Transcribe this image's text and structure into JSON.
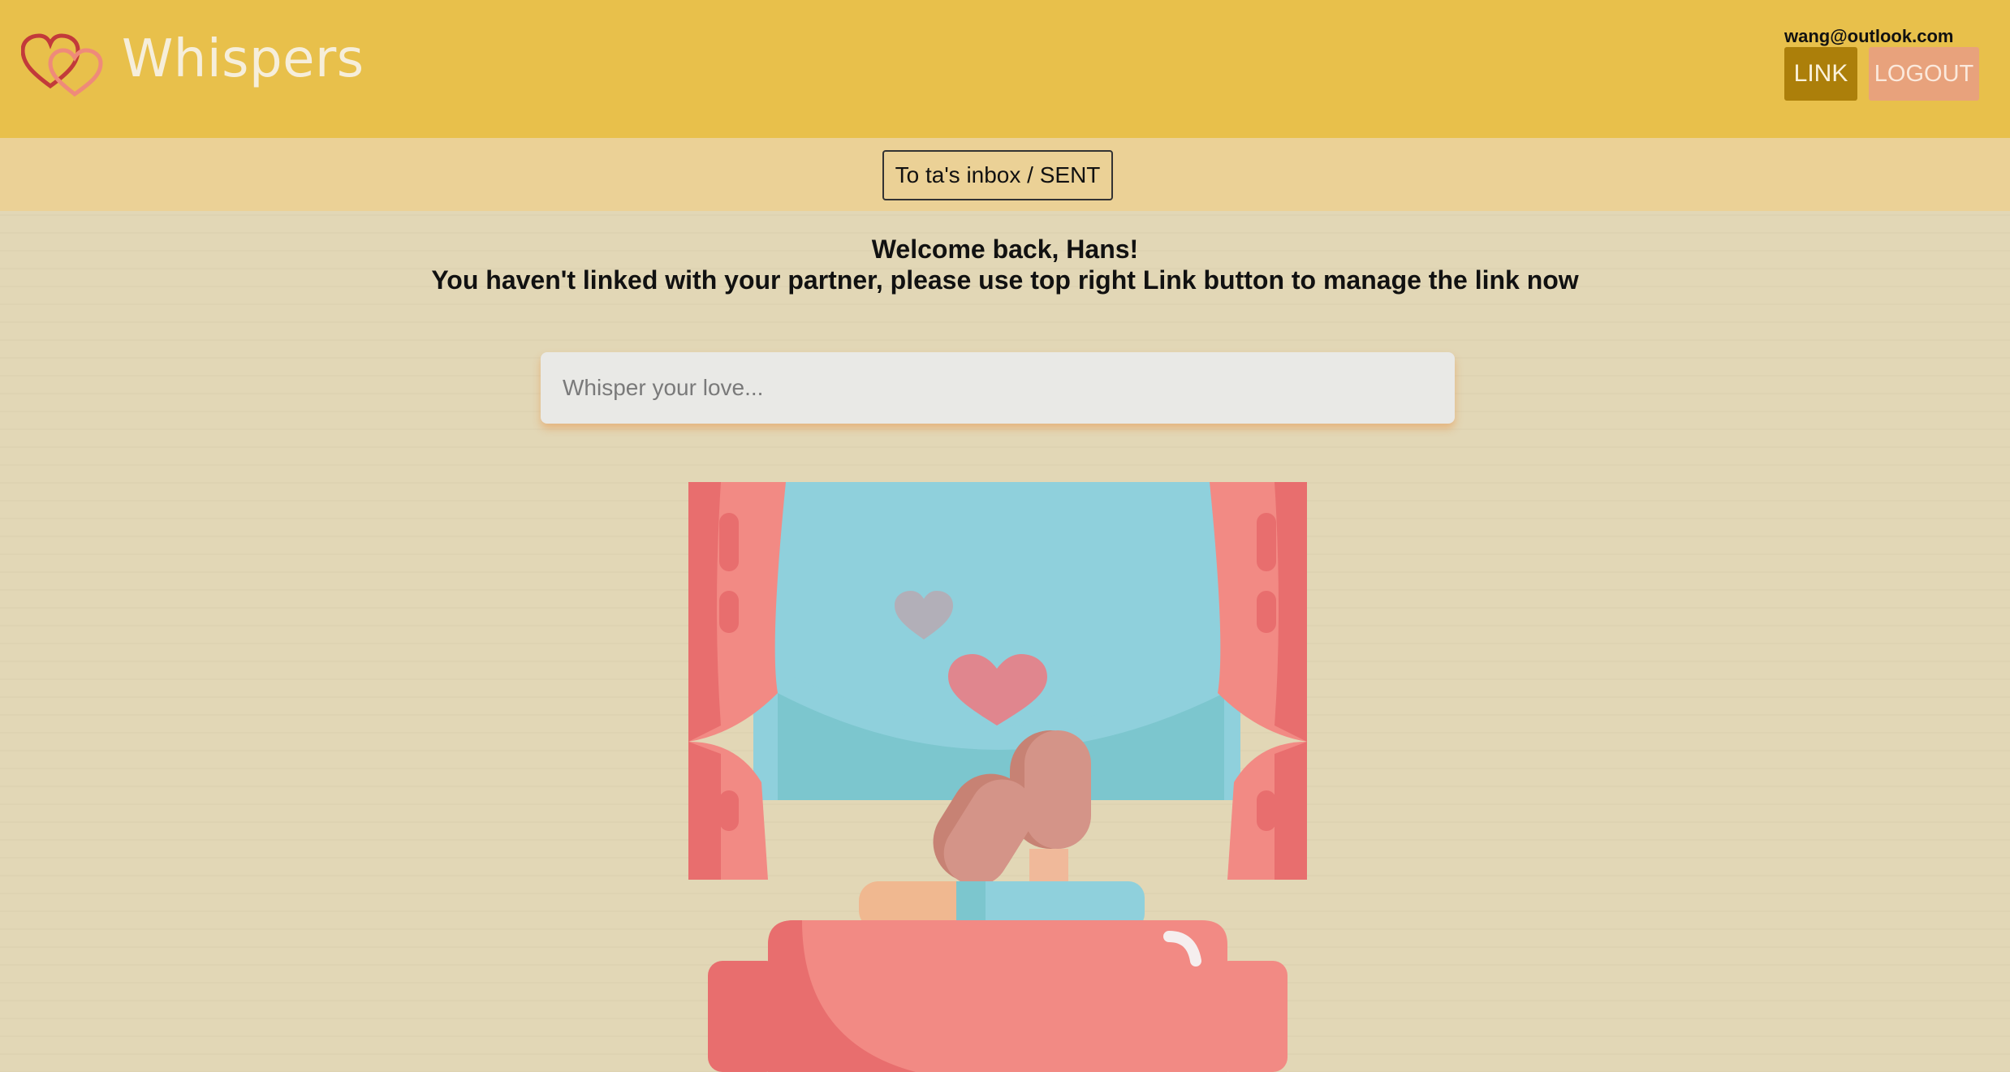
{
  "header": {
    "brand": "Whispers",
    "user_email": "wang@outlook.com",
    "link_label": "LINK",
    "logout_label": "LOGOUT",
    "logo_icon": "hearts-logo-icon"
  },
  "nav": {
    "inbox_toggle_label": "To ta's inbox / SENT"
  },
  "main": {
    "welcome_line1": "Welcome back, Hans!",
    "welcome_line2": "You haven't linked with your partner, please use top right Link button to manage the link now",
    "whisper_placeholder": "Whisper your love...",
    "illustration_icon": "couple-window-illustration"
  },
  "colors": {
    "header_bg": "#e8c04b",
    "subbar_bg": "#ebd196",
    "page_bg": "#e2d7b6",
    "link_button": "#ac7f0a",
    "logout_button": "#e8a27c"
  }
}
